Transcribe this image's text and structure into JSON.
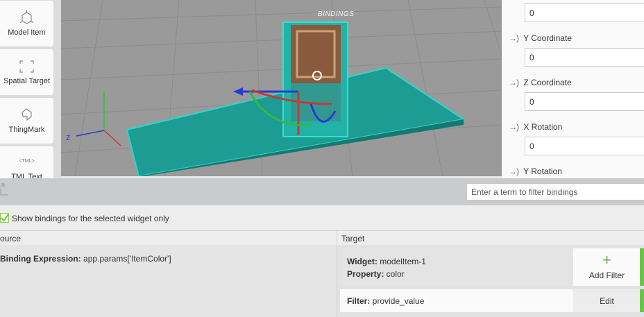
{
  "palette": {
    "items": [
      {
        "label": "Model Item",
        "icon": "model-item-icon"
      },
      {
        "label": "Spatial Target",
        "icon": "spatial-target-icon"
      },
      {
        "label": "ThingMark",
        "icon": "thingmark-icon"
      },
      {
        "label": "TML Text",
        "icon": "tml-text-icon",
        "icon_text": "<TML>"
      }
    ]
  },
  "viewport": {
    "axis_z_label": "Z",
    "accent_color": "#1aa39a"
  },
  "properties": {
    "x_value": "0",
    "fields": [
      {
        "label": "Y Coordinate",
        "value": "0"
      },
      {
        "label": "Z Coordinate",
        "value": "0"
      },
      {
        "label": "X Rotation",
        "value": "0"
      },
      {
        "label": "Y Rotation",
        "value": ""
      }
    ],
    "bind_icon": "→)"
  },
  "bindings": {
    "title": "BINDINGS",
    "filter_placeholder": "Enter a term to filter bindings",
    "show_selected_only_label": "Show bindings for the selected widget only",
    "show_selected_only_checked": true,
    "columns": {
      "source": "ource",
      "target": "Target"
    },
    "source": {
      "expression_label": "Binding Expression:",
      "expression_value": " app.params['ItemColor']"
    },
    "target": {
      "widget_label": "Widget:",
      "widget_value": " modelItem-1",
      "property_label": "Property:",
      "property_value": " color",
      "add_filter_label": "Add Filter",
      "filter_label": "Filter:",
      "filter_value": " provide_value",
      "edit_label": "Edit"
    },
    "accent_color": "#6cc24a"
  }
}
